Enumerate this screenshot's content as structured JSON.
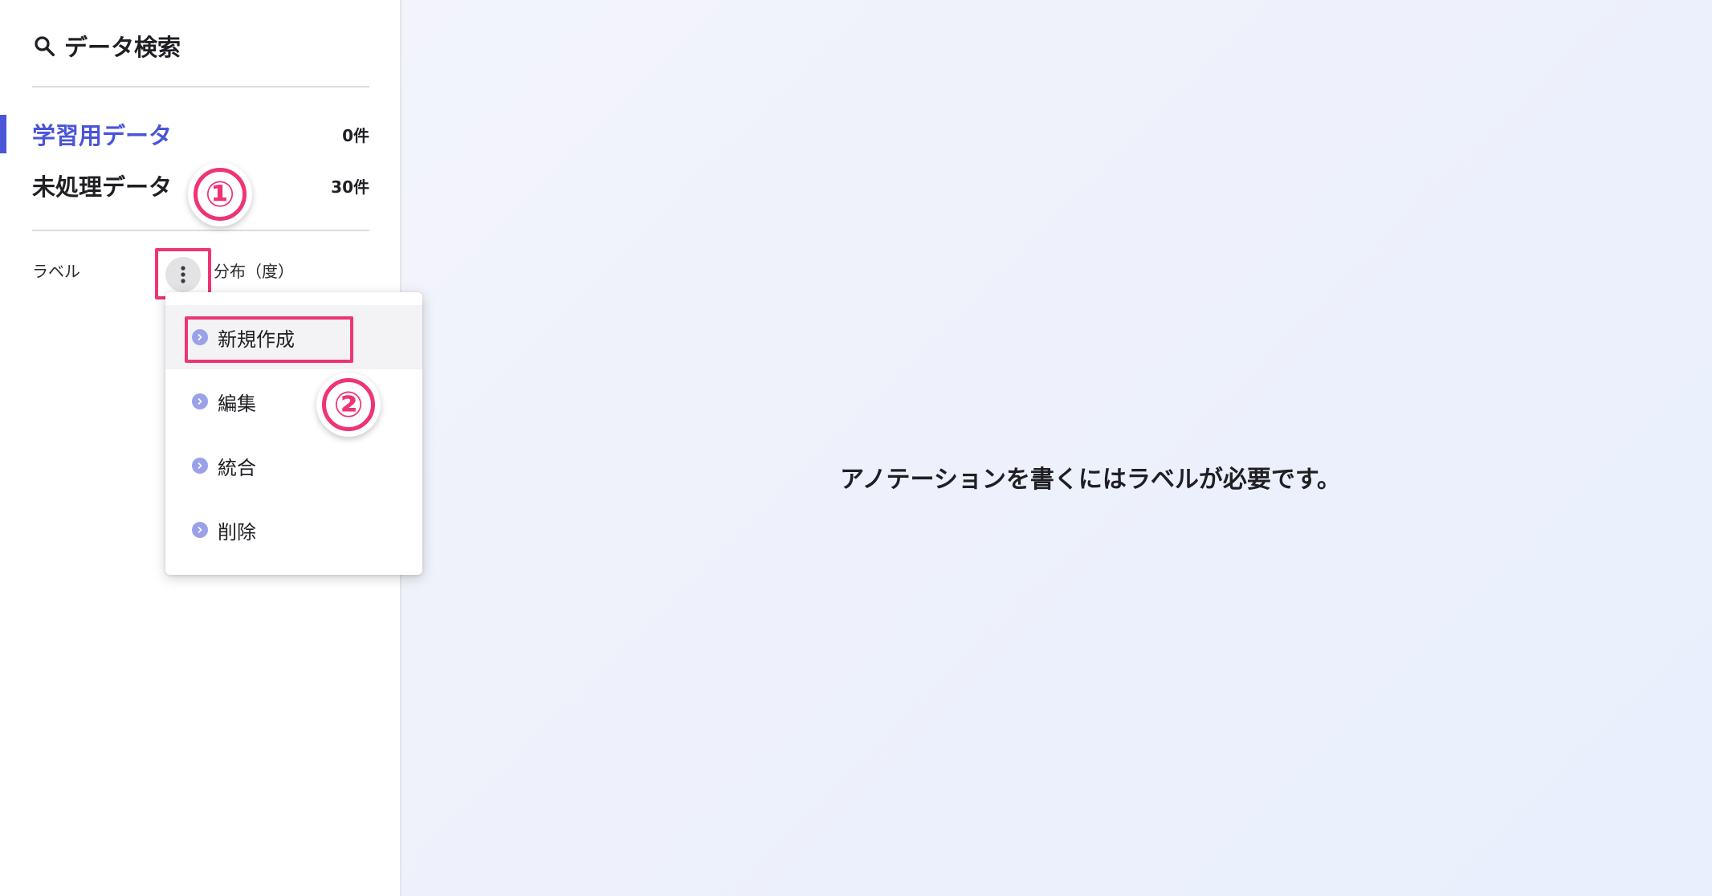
{
  "sidebar": {
    "search_label": "データ検索",
    "nav": [
      {
        "label": "学習用データ",
        "count": "0件",
        "active": true
      },
      {
        "label": "未処理データ",
        "count": "30件",
        "active": false
      }
    ],
    "label_header": "ラベル",
    "distribution_header": "分布（度）"
  },
  "menu": {
    "items": [
      {
        "label": "新規作成"
      },
      {
        "label": "編集"
      },
      {
        "label": "統合"
      },
      {
        "label": "削除"
      }
    ]
  },
  "annotations": {
    "step1": "①",
    "step2": "②"
  },
  "main": {
    "empty_message": "アノテーションを書くにはラベルが必要です。"
  },
  "colors": {
    "accent": "#4a55d8",
    "highlight": "#ee3477",
    "menu_chevron": "#9aa1ea"
  },
  "icons": {
    "search": "search-icon",
    "kebab": "more-vertical-icon",
    "chevron": "chevron-right-circle-icon"
  }
}
